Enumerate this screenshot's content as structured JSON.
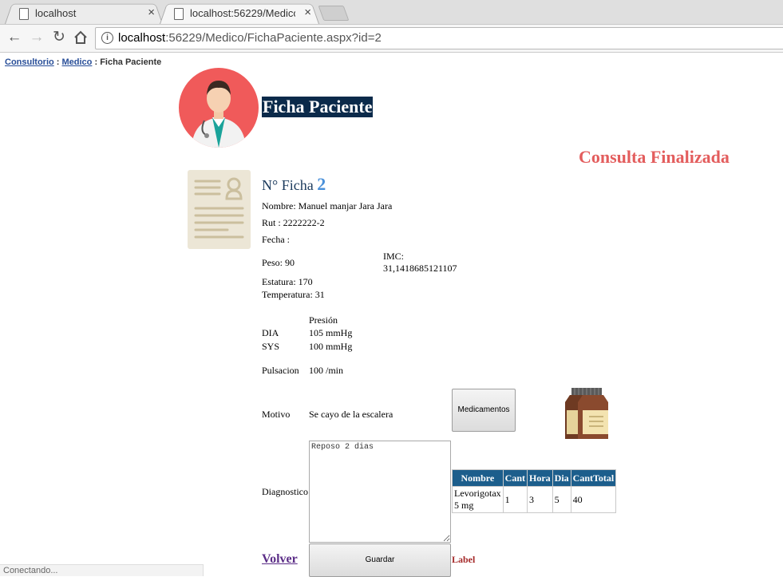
{
  "browser": {
    "tabs": [
      {
        "title": "localhost",
        "close": "×"
      },
      {
        "title": "localhost:56229/Medico/",
        "close": "×"
      }
    ],
    "url_host": "localhost",
    "url_path": ":56229/Medico/FichaPaciente.aspx?id=2",
    "status_text": "Conectando..."
  },
  "breadcrumb": {
    "root": "Consultorio",
    "sep1": " : ",
    "section": "Medico",
    "sep2": " : ",
    "current": "Ficha Paciente"
  },
  "header": {
    "title": "Ficha Paciente",
    "status": "Consulta Finalizada"
  },
  "patient": {
    "ficha_label": "N° Ficha",
    "ficha_number": "2",
    "nombre": "Nombre:  Manuel manjar Jara Jara",
    "rut": "Rut : 2222222-2",
    "fecha": "Fecha :",
    "peso": "Peso:  90",
    "imc_label": "IMC:",
    "imc_value": "31,1418685121107",
    "estatura": "Estatura:  170",
    "temperatura": "Temperatura:  31",
    "presion_label": "Presión",
    "dia_label": "DIA",
    "dia_value": "105 mmHg",
    "sys_label": "SYS",
    "sys_value": "100 mmHg",
    "pulsacion_label": "Pulsacion",
    "pulsacion_value": "100 /min",
    "motivo_label": "Motivo",
    "motivo_value": "Se cayo de la escalera",
    "diagnostico_label": "Diagnostico",
    "diagnostico_value": "Reposo 2 dias"
  },
  "buttons": {
    "medicamentos": "Medicamentos",
    "guardar": "Guardar",
    "volver": "Volver",
    "label": "Label"
  },
  "meds_table": {
    "headers": [
      "Nombre",
      "Cant",
      "Hora",
      "Dia",
      "CantTotal"
    ],
    "rows": [
      [
        "Levorigotax 5 mg",
        "1",
        "3",
        "5",
        "40"
      ]
    ]
  },
  "colors": {
    "title_bg": "#0b2a4a",
    "status": "#e35d5d",
    "table_header": "#1c5e8c"
  }
}
